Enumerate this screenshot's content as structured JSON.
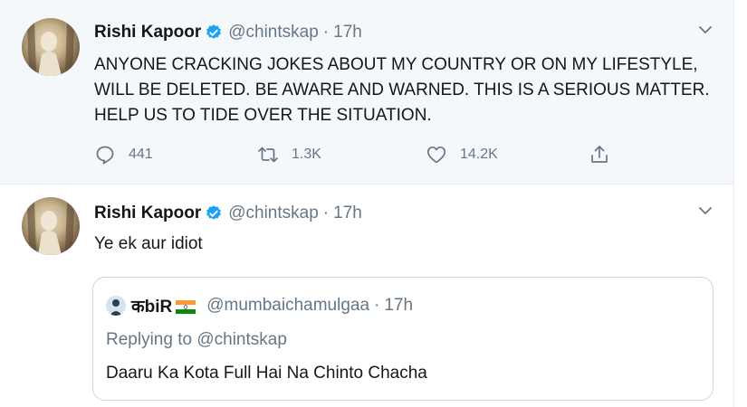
{
  "colors": {
    "primary_text": "#14171a",
    "secondary_text": "#657786",
    "verified_blue": "#1da1f2",
    "highlight_bg": "#f5f8fa",
    "border": "#e6ecf0"
  },
  "tweets": [
    {
      "author_name": "Rishi Kapoor",
      "handle": "@chintskap",
      "separator": "·",
      "time": "17h",
      "text": "ANYONE CRACKING JOKES ABOUT MY COUNTRY OR ON MY LIFESTYLE,\nWILL BE DELETED. BE AWARE AND WARNED. THIS IS A SERIOUS MATTER.\nHELP US TO TIDE OVER THE SITUATION.",
      "reply_count": "441",
      "retweet_count": "1.3K",
      "like_count": "14.2K",
      "icons": [
        "verified-badge-icon",
        "chevron-down-icon",
        "reply-icon",
        "retweet-icon",
        "like-heart-icon",
        "share-icon"
      ]
    },
    {
      "author_name": "Rishi Kapoor",
      "handle": "@chintskap",
      "separator": "·",
      "time": "17h",
      "text": "Ye ek aur idiot",
      "quoted": {
        "author_name": "कbiR",
        "handle": "@mumbaichamulgaa",
        "separator": "·",
        "time": "17h",
        "replying_to": "Replying to @chintskap",
        "text": "Daaru Ka Kota Full Hai Na Chinto Chacha",
        "icons": [
          "india-flag-icon"
        ]
      }
    }
  ]
}
